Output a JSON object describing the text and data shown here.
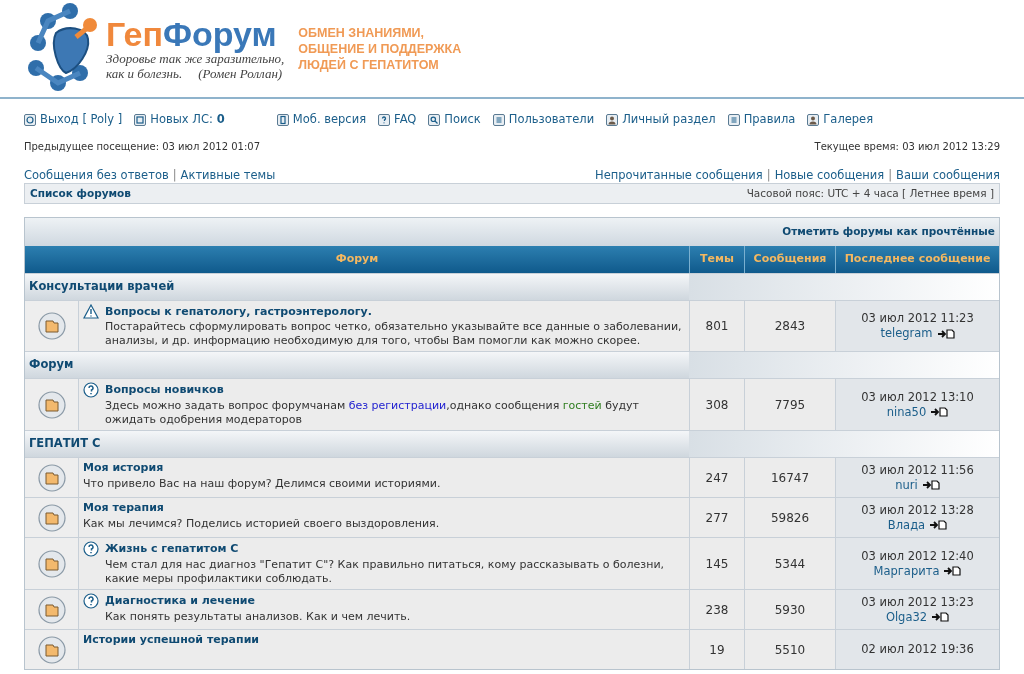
{
  "logo": {
    "name_parts": [
      "Геп",
      "Форум"
    ],
    "quote": [
      "Здоровье так же заразительно,",
      "как и болезнь.",
      "(Ромен Роллан)"
    ],
    "tagline": [
      "ОБМЕН ЗНАНИЯМИ,",
      "ОБЩЕНИЕ И ПОДДЕРЖКА",
      "ЛЮДЕЙ С ГЕПАТИТОМ"
    ]
  },
  "nav_groups": [
    [
      {
        "kind": "power",
        "label": "Выход [ Poly ]"
      },
      {
        "kind": "mail",
        "label": "Новых ЛС:",
        "count": "0"
      }
    ],
    [
      {
        "kind": "mobile",
        "label": "Моб. версия"
      },
      {
        "kind": "faq",
        "label": "FAQ"
      },
      {
        "kind": "search",
        "label": "Поиск"
      },
      {
        "kind": "list",
        "label": "Пользователи"
      },
      {
        "kind": "person",
        "label": "Личный раздел"
      },
      {
        "kind": "list",
        "label": "Правила"
      },
      {
        "kind": "person",
        "label": "Галерея"
      }
    ]
  ],
  "separator": "|",
  "previous_visit": "Предыдущее посещение: 03 июл 2012 01:07",
  "current_time": "Текущее время: 03 июл 2012 13:29",
  "links_left": [
    "Сообщения без ответов",
    "Активные темы"
  ],
  "links_right": [
    "Непрочитанные сообщения",
    "Новые сообщения",
    "Ваши сообщения"
  ],
  "breadcrumb": "Список форумов",
  "timezone": "Часовой пояс: UTC + 4 часа [ Летнее время ]",
  "mark_read": "Отметить форумы как прочтённые",
  "columns": [
    "Форум",
    "Темы",
    "Сообщения",
    "Последнее сообщение"
  ],
  "categories": [
    {
      "title": "Консультации врачей",
      "forums": [
        {
          "kind": "warning",
          "title": "Вопросы к гепатологу, гастроэнтерологу.",
          "description": [
            {
              "kind": "text",
              "text": "Постарайтесь сформулировать вопрос четко, обязательно указывайте все данные о заболевании, анализы, и др. информацию необходимую для того, чтобы Вам помогли как можно скорее."
            }
          ],
          "topics": "801",
          "posts": "2843",
          "last_date": "03 июл 2012 11:23",
          "last_user": "telegram"
        }
      ]
    },
    {
      "title": "Форум",
      "forums": [
        {
          "kind": "question",
          "title": "Вопросы новичков",
          "description": [
            {
              "kind": "text",
              "text": "Здесь можно задать вопрос форумчанам "
            },
            {
              "kind": "link",
              "text": "без регистрации"
            },
            {
              "kind": "text",
              "text": ",однако сообщения "
            },
            {
              "kind": "guest",
              "text": "гостей"
            },
            {
              "kind": "text",
              "text": " будут ожидать одобрения модераторов"
            }
          ],
          "topics": "308",
          "posts": "7795",
          "last_date": "03 июл 2012 13:10",
          "last_user": "nina50"
        }
      ]
    },
    {
      "title": "ГЕПАТИТ C",
      "forums": [
        {
          "kind": "plain",
          "title": "Моя история",
          "description": [
            {
              "kind": "text",
              "text": "Что привело Вас на наш форум? Делимся своими историями."
            }
          ],
          "topics": "247",
          "posts": "16747",
          "last_date": "03 июл 2012 11:56",
          "last_user": "nuri"
        },
        {
          "kind": "plain",
          "title": "Моя терапия",
          "description": [
            {
              "kind": "text",
              "text": "Как мы лечимся? Поделись историей своего выздоровления."
            }
          ],
          "topics": "277",
          "posts": "59826",
          "last_date": "03 июл 2012 13:28",
          "last_user": "Влада"
        },
        {
          "kind": "question",
          "title": "Жизнь с гепатитом С",
          "description": [
            {
              "kind": "text",
              "text": "Чем стал для нас диагноз \"Гепатит С\"? Как правильно питаться, кому рассказывать о болезни, какие меры профилактики соблюдать."
            }
          ],
          "topics": "145",
          "posts": "5344",
          "last_date": "03 июл 2012 12:40",
          "last_user": "Маргарита"
        },
        {
          "kind": "question",
          "title": "Диагностика и лечение",
          "description": [
            {
              "kind": "text",
              "text": "Как понять результаты анализов. Как и чем лечить."
            }
          ],
          "topics": "238",
          "posts": "5930",
          "last_date": "03 июл 2012 13:23",
          "last_user": "Olga32"
        },
        {
          "kind": "plain",
          "title": "Истории успешной терапии",
          "topics": "19",
          "posts": "5510",
          "last_date": "02 июл 2012 19:36"
        }
      ]
    }
  ]
}
